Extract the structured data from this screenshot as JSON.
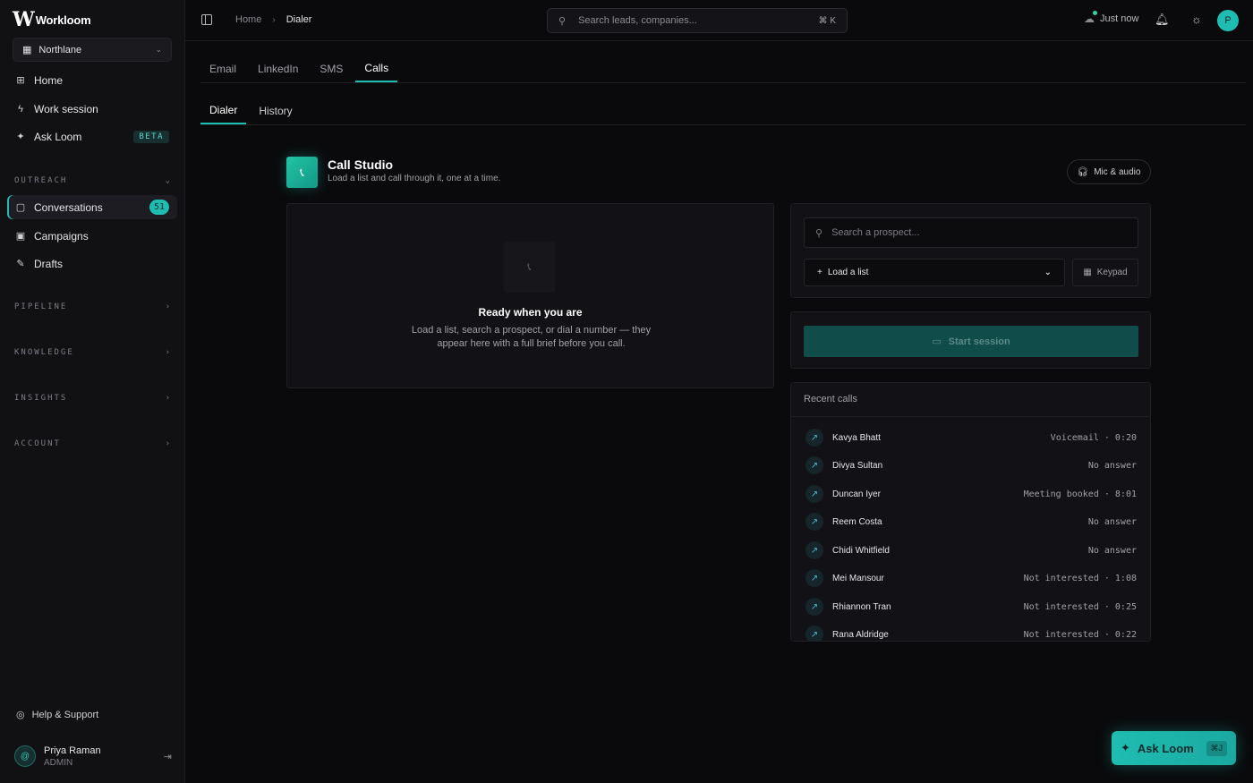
{
  "app": {
    "logo_mark": "W",
    "name": "Workloom"
  },
  "org": {
    "name": "Northlane"
  },
  "sidebar": {
    "nav": [
      {
        "label": "Home"
      },
      {
        "label": "Work session"
      },
      {
        "label": "Ask Loom",
        "badge": "BETA"
      }
    ],
    "outreach": {
      "title": "OUTREACH",
      "items": [
        {
          "label": "Conversations",
          "count": "51"
        },
        {
          "label": "Campaigns"
        },
        {
          "label": "Drafts"
        }
      ]
    },
    "sections": [
      {
        "title": "PIPELINE"
      },
      {
        "title": "KNOWLEDGE"
      },
      {
        "title": "INSIGHTS"
      },
      {
        "title": "ACCOUNT"
      }
    ],
    "help": "Help & Support",
    "user": {
      "name": "Priya Raman",
      "role": "ADMIN",
      "avatar": "@"
    }
  },
  "topbar": {
    "breadcrumb": [
      "Home",
      "Dialer"
    ],
    "search_placeholder": "Search leads, companies...",
    "search_shortcut": "⌘ K",
    "sync_status": "Just now",
    "avatar": "P"
  },
  "tabs": [
    {
      "label": "Email"
    },
    {
      "label": "LinkedIn"
    },
    {
      "label": "SMS"
    },
    {
      "label": "Calls",
      "active": true
    }
  ],
  "subtabs": [
    {
      "label": "Dialer",
      "active": true
    },
    {
      "label": "History"
    }
  ],
  "studio": {
    "title": "Call Studio",
    "subtitle": "Load a list and call through it, one at a time.",
    "mic_button": "Mic & audio"
  },
  "empty": {
    "title": "Ready when you are",
    "description": "Load a list, search a prospect, or dial a number — they appear here with a full brief before you call."
  },
  "controls": {
    "prospect_placeholder": "Search a prospect...",
    "load_list": "Load a list",
    "keypad": "Keypad",
    "start_session": "Start session"
  },
  "recent_calls": {
    "title": "Recent calls",
    "rows": [
      {
        "name": "Kavya Bhatt",
        "status": "Voicemail · 0:20"
      },
      {
        "name": "Divya Sultan",
        "status": "No answer"
      },
      {
        "name": "Duncan Iyer",
        "status": "Meeting booked · 8:01"
      },
      {
        "name": "Reem Costa",
        "status": "No answer"
      },
      {
        "name": "Chidi Whitfield",
        "status": "No answer"
      },
      {
        "name": "Mei Mansour",
        "status": "Not interested · 1:08"
      },
      {
        "name": "Rhiannon Tran",
        "status": "Not interested · 0:25"
      },
      {
        "name": "Rana Aldridge",
        "status": "Not interested · 0:22"
      }
    ]
  },
  "fab": {
    "label": "Ask Loom",
    "shortcut": "⌘J"
  },
  "colors": {
    "accent": "#1fbdb1",
    "background": "#0a0a0c",
    "sidebar": "#111114"
  }
}
